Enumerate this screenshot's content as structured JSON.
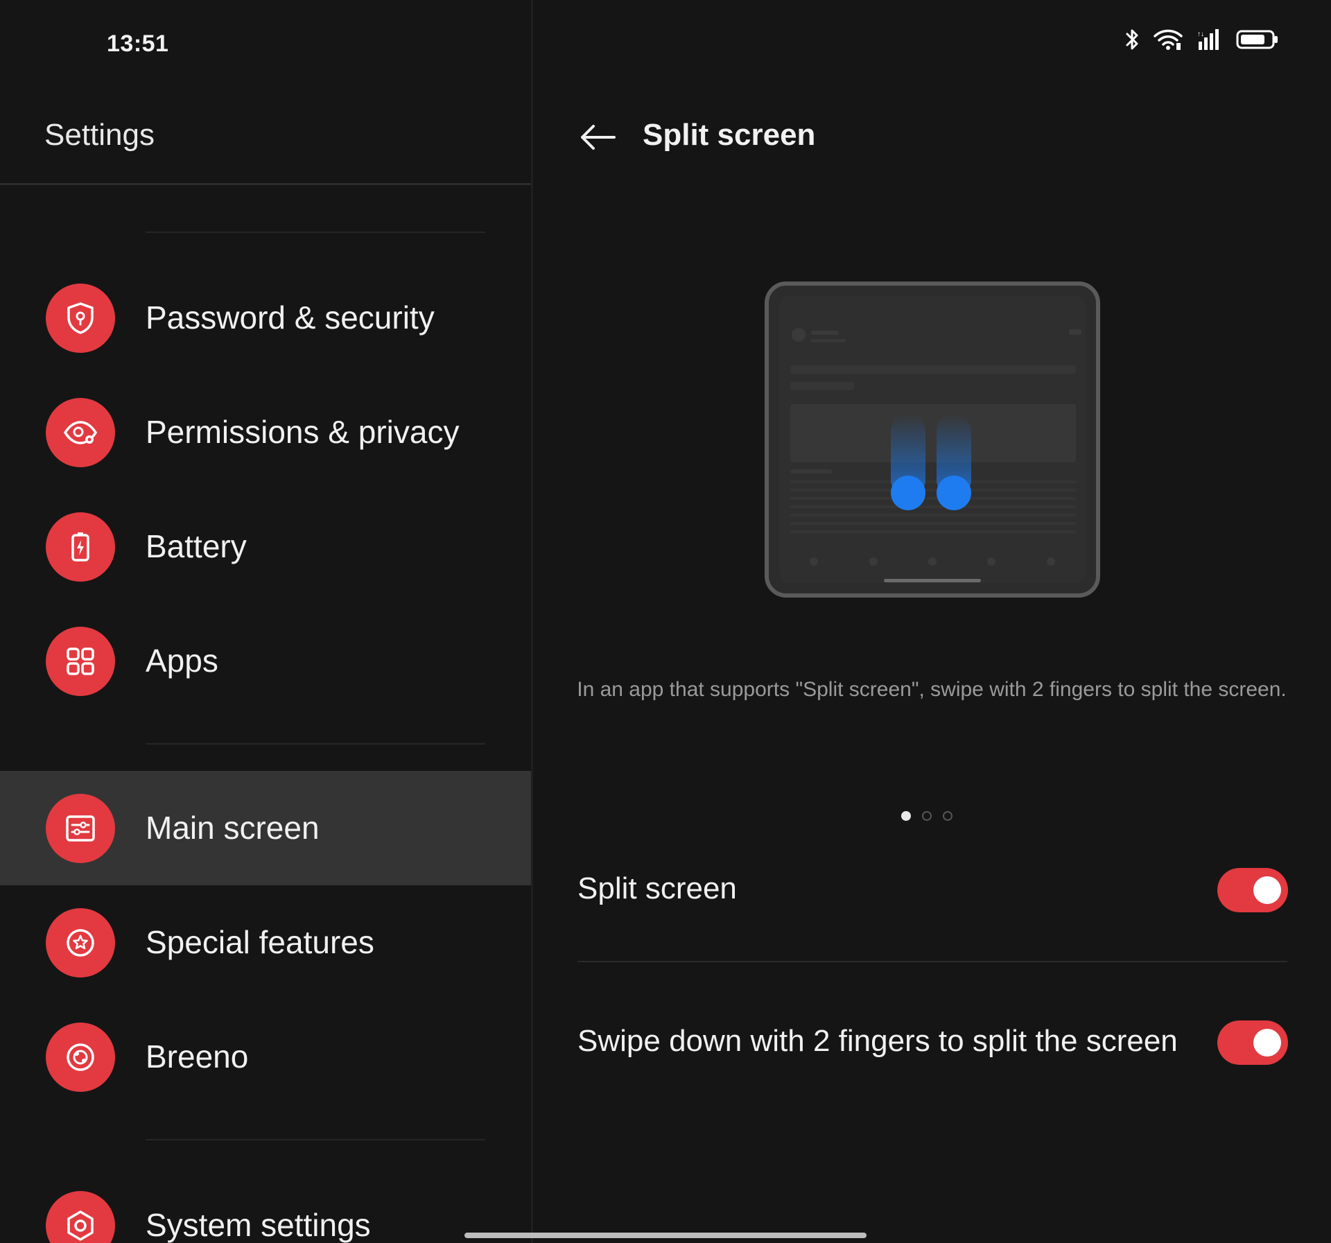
{
  "status_bar": {
    "time": "13:51",
    "icons": [
      "bluetooth-icon",
      "wifi-icon",
      "cellular-signal-icon",
      "battery-icon"
    ]
  },
  "left_pane": {
    "title": "Settings",
    "items": [
      {
        "label": "Password & security",
        "icon": "shield-lock-icon"
      },
      {
        "label": "Permissions & privacy",
        "icon": "eye-settings-icon"
      },
      {
        "label": "Battery",
        "icon": "battery-icon"
      },
      {
        "label": "Apps",
        "icon": "apps-grid-icon"
      },
      {
        "label": "Main screen",
        "icon": "main-screen-icon",
        "selected": true
      },
      {
        "label": "Special features",
        "icon": "star-circle-icon"
      },
      {
        "label": "Breeno",
        "icon": "breeno-icon"
      },
      {
        "label": "System settings",
        "icon": "gear-icon"
      }
    ]
  },
  "right_pane": {
    "title": "Split screen",
    "back_icon": "back-arrow-icon",
    "caption": "In an app that supports \"Split screen\", swipe with 2 fingers to split the screen.",
    "carousel": {
      "total": 3,
      "active": 1
    },
    "settings": [
      {
        "label": "Split screen",
        "enabled": true
      },
      {
        "label": "Swipe down with 2 fingers to split the screen",
        "enabled": true
      }
    ]
  },
  "colors": {
    "accent": "#e23a40",
    "background": "#151515",
    "selected_row": "#343434",
    "gesture_dot": "#1e7cf0"
  }
}
